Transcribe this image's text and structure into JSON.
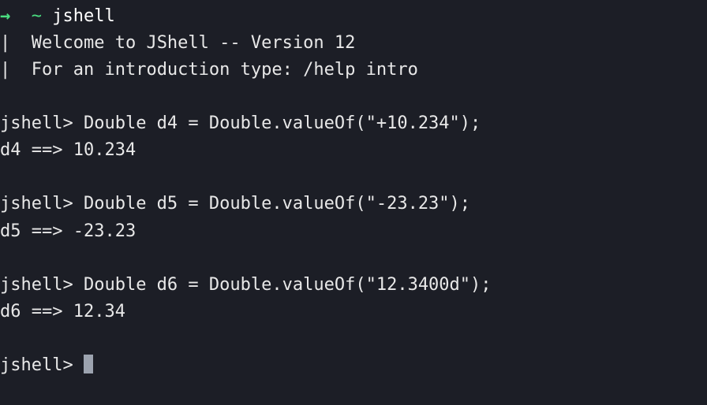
{
  "header": {
    "arrow": "→",
    "tilde": "~",
    "command": "jshell"
  },
  "welcome": {
    "line1_prefix": "|  ",
    "line1_text": "Welcome to JShell -- Version 12",
    "line2_prefix": "|  ",
    "line2_text": "For an introduction type: /help intro"
  },
  "entries": [
    {
      "prompt": "jshell> ",
      "input": "Double d4 = Double.valueOf(\"+10.234\");",
      "result": "d4 ==> 10.234"
    },
    {
      "prompt": "jshell> ",
      "input": "Double d5 = Double.valueOf(\"-23.23\");",
      "result": "d5 ==> -23.23"
    },
    {
      "prompt": "jshell> ",
      "input": "Double d6 = Double.valueOf(\"12.3400d\");",
      "result": "d6 ==> 12.34"
    }
  ],
  "final_prompt": "jshell> "
}
